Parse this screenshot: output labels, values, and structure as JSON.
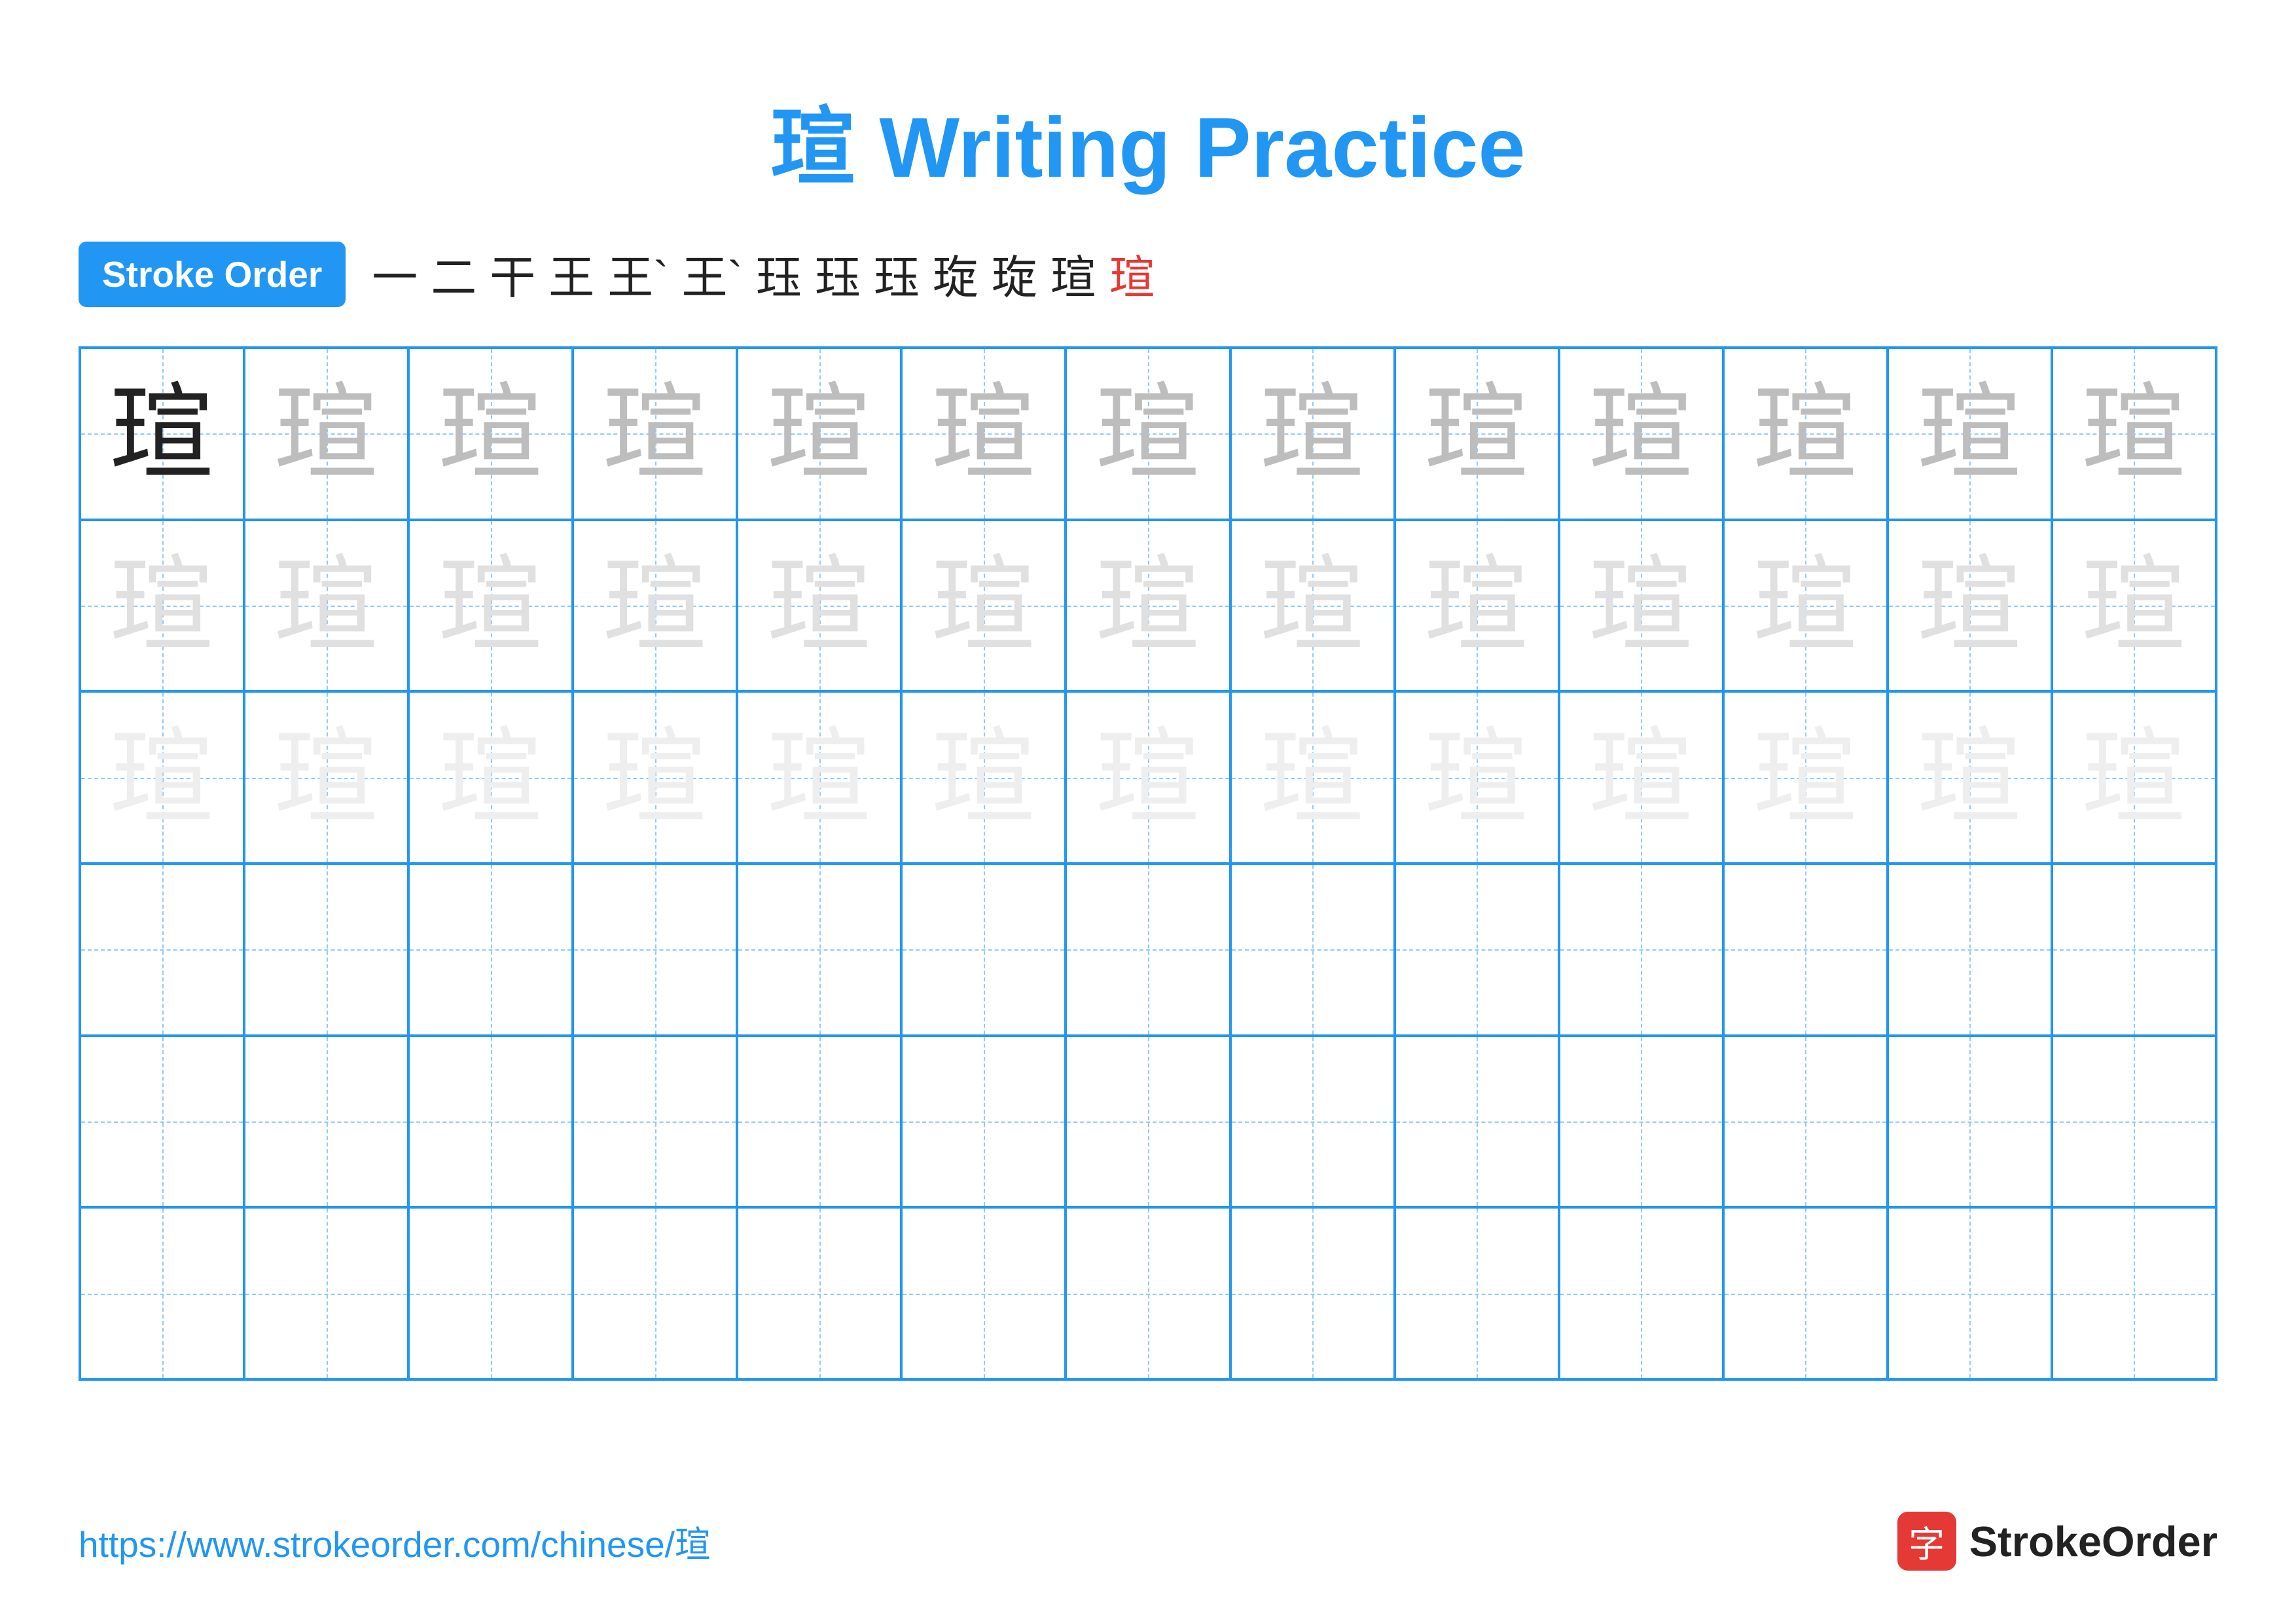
{
  "title": "瑄 Writing Practice",
  "stroke_order": {
    "badge_label": "Stroke Order",
    "steps": [
      "一",
      "二",
      "干",
      "王",
      "王`",
      "王`",
      "珏",
      "珏",
      "珏",
      "琁",
      "琁",
      "瑄",
      "瑄"
    ]
  },
  "grid": {
    "rows": 6,
    "cols": 13,
    "character": "瑄",
    "cells": [
      {
        "row": 0,
        "col": 0,
        "style": "dark"
      },
      {
        "row": 0,
        "col": 1,
        "style": "medium-gray"
      },
      {
        "row": 0,
        "col": 2,
        "style": "medium-gray"
      },
      {
        "row": 0,
        "col": 3,
        "style": "medium-gray"
      },
      {
        "row": 0,
        "col": 4,
        "style": "medium-gray"
      },
      {
        "row": 0,
        "col": 5,
        "style": "medium-gray"
      },
      {
        "row": 0,
        "col": 6,
        "style": "medium-gray"
      },
      {
        "row": 0,
        "col": 7,
        "style": "medium-gray"
      },
      {
        "row": 0,
        "col": 8,
        "style": "medium-gray"
      },
      {
        "row": 0,
        "col": 9,
        "style": "medium-gray"
      },
      {
        "row": 0,
        "col": 10,
        "style": "medium-gray"
      },
      {
        "row": 0,
        "col": 11,
        "style": "medium-gray"
      },
      {
        "row": 0,
        "col": 12,
        "style": "medium-gray"
      },
      {
        "row": 1,
        "col": 0,
        "style": "light-gray"
      },
      {
        "row": 1,
        "col": 1,
        "style": "light-gray"
      },
      {
        "row": 1,
        "col": 2,
        "style": "light-gray"
      },
      {
        "row": 1,
        "col": 3,
        "style": "light-gray"
      },
      {
        "row": 1,
        "col": 4,
        "style": "light-gray"
      },
      {
        "row": 1,
        "col": 5,
        "style": "light-gray"
      },
      {
        "row": 1,
        "col": 6,
        "style": "light-gray"
      },
      {
        "row": 1,
        "col": 7,
        "style": "light-gray"
      },
      {
        "row": 1,
        "col": 8,
        "style": "light-gray"
      },
      {
        "row": 1,
        "col": 9,
        "style": "light-gray"
      },
      {
        "row": 1,
        "col": 10,
        "style": "light-gray"
      },
      {
        "row": 1,
        "col": 11,
        "style": "light-gray"
      },
      {
        "row": 1,
        "col": 12,
        "style": "light-gray"
      },
      {
        "row": 2,
        "col": 0,
        "style": "very-light"
      },
      {
        "row": 2,
        "col": 1,
        "style": "very-light"
      },
      {
        "row": 2,
        "col": 2,
        "style": "very-light"
      },
      {
        "row": 2,
        "col": 3,
        "style": "very-light"
      },
      {
        "row": 2,
        "col": 4,
        "style": "very-light"
      },
      {
        "row": 2,
        "col": 5,
        "style": "very-light"
      },
      {
        "row": 2,
        "col": 6,
        "style": "very-light"
      },
      {
        "row": 2,
        "col": 7,
        "style": "very-light"
      },
      {
        "row": 2,
        "col": 8,
        "style": "very-light"
      },
      {
        "row": 2,
        "col": 9,
        "style": "very-light"
      },
      {
        "row": 2,
        "col": 10,
        "style": "very-light"
      },
      {
        "row": 2,
        "col": 11,
        "style": "very-light"
      },
      {
        "row": 2,
        "col": 12,
        "style": "very-light"
      }
    ]
  },
  "footer": {
    "url": "https://www.strokeorder.com/chinese/瑄",
    "logo_text": "StrokeOrder",
    "logo_icon": "字"
  }
}
